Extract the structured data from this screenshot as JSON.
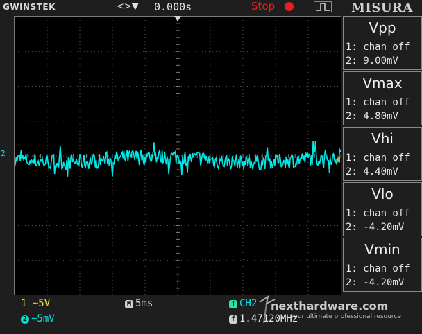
{
  "header": {
    "brand": "GWINSTEK",
    "trigger_arrows": "<>▼",
    "trigger_delay": "0.000s",
    "run_state": "Stop",
    "menu_title": "MISURA"
  },
  "channel_marker": "2",
  "measurements": [
    {
      "title": "Vpp",
      "ch1": "1: chan off",
      "ch2": "2: 9.00mV"
    },
    {
      "title": "Vmax",
      "ch1": "1: chan off",
      "ch2": "2: 4.80mV"
    },
    {
      "title": "Vhi",
      "ch1": "1: chan off",
      "ch2": "2: 4.40mV"
    },
    {
      "title": "Vlo",
      "ch1": "1: chan off",
      "ch2": "2: -4.20mV"
    },
    {
      "title": "Vmin",
      "ch1": "1: chan off",
      "ch2": "2: -4.20mV"
    }
  ],
  "footer": {
    "ch1_label": "1",
    "ch1_scale": "~5V",
    "ch2_label": "2",
    "ch2_scale": "~5mV",
    "timebase_icon": "M",
    "timebase": "5ms",
    "trigger_icon": "T",
    "trigger_source": "CH2",
    "freq_icon": "f",
    "frequency": "1.47120MHz"
  },
  "watermark": {
    "text": "nexthardware.com",
    "tagline": "your ultimate professional resource"
  },
  "colors": {
    "background": "#1e1e1e",
    "grid": "#000000",
    "ch1": "#f0e040",
    "ch2": "#00e8e8",
    "stop": "#e52020"
  },
  "icons": {
    "run_state": "stop-dot-icon",
    "trigger_edge": "rising-edge-icon",
    "trigger_marker": "trigger-position-icon"
  },
  "waveform": {
    "channel": 2,
    "samples_per_division": 40,
    "divisions": 10,
    "offset_div": -0.1,
    "noise_pp_div": 1.8
  }
}
